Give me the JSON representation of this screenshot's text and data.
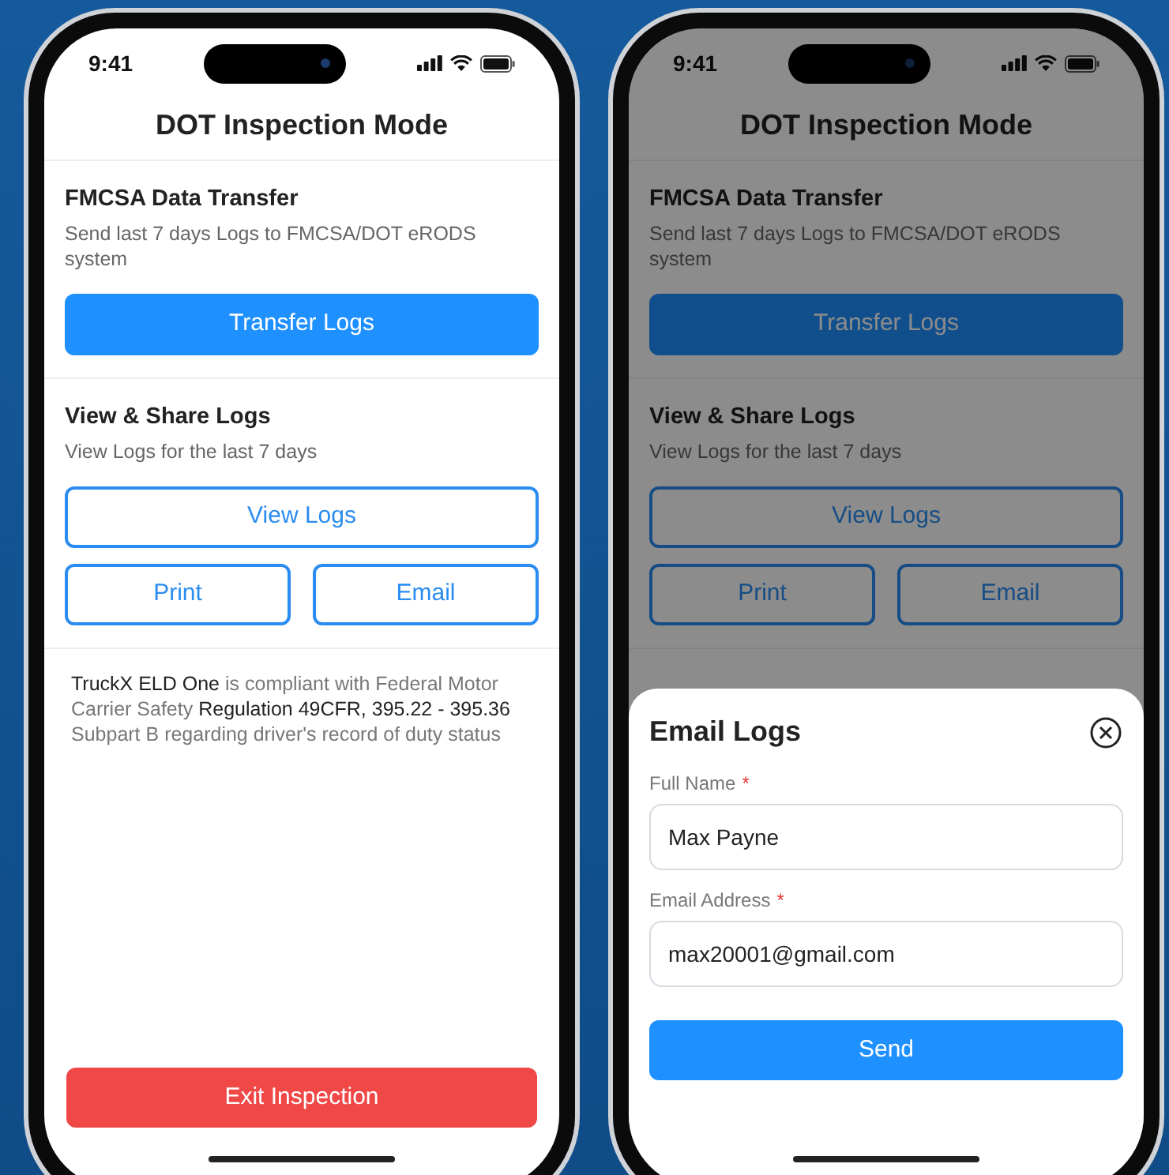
{
  "phones": [
    {
      "dimmed": false,
      "status_bar": {
        "time": "9:41"
      },
      "title": "DOT Inspection Mode",
      "sections": [
        {
          "title": "FMCSA Data Transfer",
          "description": "Send last 7 days Logs to FMCSA/DOT eRODS system",
          "buttons": [
            [
              {
                "label": "Transfer Logs",
                "kind": "filled"
              }
            ]
          ]
        },
        {
          "title": "View & Share Logs",
          "description": "View Logs for the last 7 days",
          "buttons": [
            [
              {
                "label": "View Logs",
                "kind": "outline"
              }
            ],
            [
              {
                "label": "Print",
                "kind": "outline"
              },
              {
                "label": "Email",
                "kind": "outline"
              }
            ]
          ]
        }
      ],
      "compliance": "**TruckX ELD One** is compliant with Federal Motor Carrier Safety **Regulation 49CFR, 395.22 - 395.36** Subpart B regarding driver's record of duty status",
      "exit_button": "Exit Inspection"
    },
    {
      "dimmed": true,
      "status_bar": {
        "time": "9:41"
      },
      "title": "DOT Inspection Mode",
      "sections": [
        {
          "title": "FMCSA Data Transfer",
          "description": "Send last 7 days Logs to FMCSA/DOT eRODS system",
          "buttons": [
            [
              {
                "label": "Transfer Logs",
                "kind": "filled"
              }
            ]
          ]
        },
        {
          "title": "View & Share Logs",
          "description": "View Logs for the last 7 days",
          "buttons": [
            [
              {
                "label": "View Logs",
                "kind": "outline"
              }
            ],
            [
              {
                "label": "Print",
                "kind": "outline"
              },
              {
                "label": "Email",
                "kind": "outline"
              }
            ]
          ]
        }
      ],
      "sheet": {
        "title": "Email Logs",
        "fields": [
          {
            "label": "Full Name",
            "required": true,
            "required_mark": "*",
            "value": "Max Payne"
          },
          {
            "label": "Email Address",
            "required": true,
            "required_mark": "*",
            "value": "max20001@gmail.com"
          }
        ],
        "button": "Send"
      }
    }
  ]
}
